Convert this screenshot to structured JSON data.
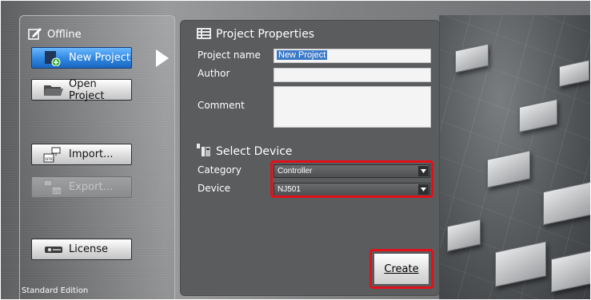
{
  "sidebar": {
    "title": "Offline",
    "buttons": {
      "new_project": "New Project",
      "open_project": "Open Project",
      "import": "Import...",
      "export": "Export...",
      "license": "License"
    },
    "edition": "Standard Edition"
  },
  "project_properties": {
    "title": "Project Properties",
    "project_name_label": "Project name",
    "project_name_value": "New Project",
    "author_label": "Author",
    "author_value": "",
    "comment_label": "Comment",
    "comment_value": ""
  },
  "select_device": {
    "title": "Select Device",
    "category_label": "Category",
    "category_value": "Controller",
    "device_label": "Device",
    "device_value": "NJ501"
  },
  "create_button": "Create",
  "colors": {
    "active_button": "#2f86e0",
    "highlight": "#e2101b",
    "panel": "#5b5c5e"
  }
}
